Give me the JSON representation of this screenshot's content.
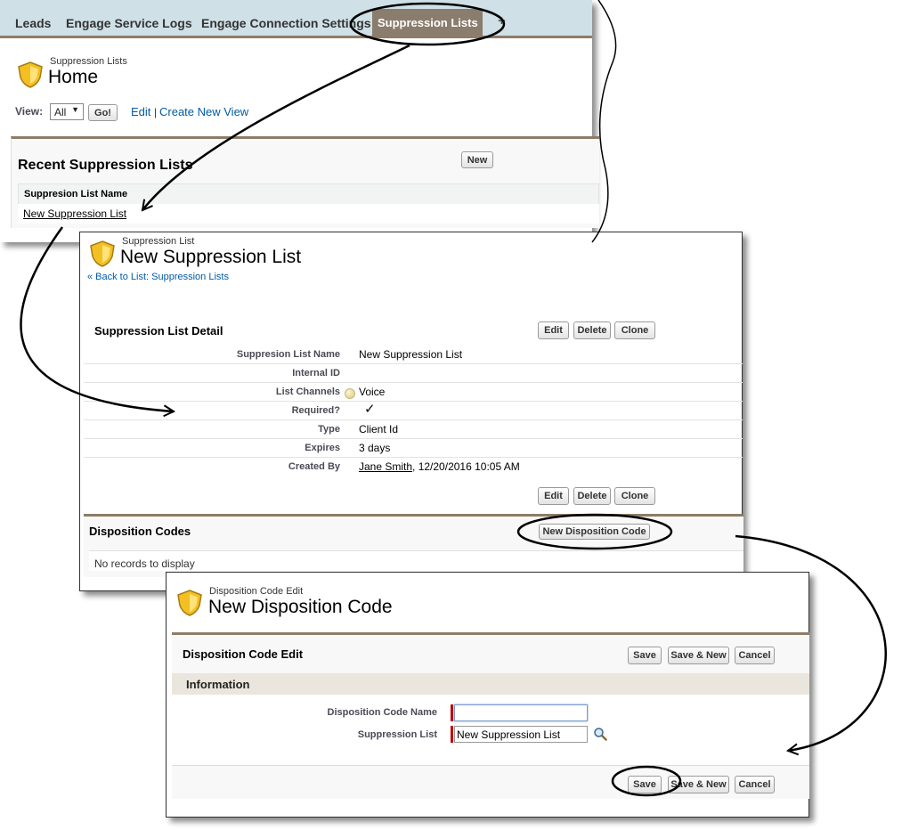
{
  "tabs": [
    "Leads",
    "Engage Service Logs",
    "Engage Connection Settings",
    "Suppression Lists"
  ],
  "tab_plus": "+",
  "home": {
    "object_label": "Suppression Lists",
    "title": "Home",
    "view_label": "View:",
    "view_value": "All",
    "go_label": "Go!",
    "edit_link": "Edit",
    "separator": "|",
    "create_view_link": "Create New View",
    "recent_title": "Recent Suppression Lists",
    "new_button": "New",
    "column_header": "Suppresion List Name",
    "row_link": "New Suppression List"
  },
  "detail": {
    "object_label": "Suppression List",
    "title": "New Suppression List",
    "back_link": "« Back to List: Suppression Lists",
    "section_title": "Suppression List Detail",
    "buttons": [
      "Edit",
      "Delete",
      "Clone"
    ],
    "fields": [
      {
        "label": "Suppresion List Name",
        "value": "New Suppression List"
      },
      {
        "label": "Internal ID",
        "value": ""
      },
      {
        "label": "List Channels",
        "value": "Voice"
      },
      {
        "label": "Required?",
        "value": "✓"
      },
      {
        "label": "Type",
        "value": "Client Id"
      },
      {
        "label": "Expires",
        "value": "3 days"
      },
      {
        "label": "Created By",
        "value_link": "Jane Smith",
        "value": ", 12/20/2016 10:05 AM"
      }
    ],
    "related_title": "Disposition Codes",
    "related_button": "New Disposition Code",
    "empty_text": "No records to display"
  },
  "edit": {
    "object_label": "Disposition Code Edit",
    "title": "New Disposition Code",
    "section_title": "Disposition Code Edit",
    "buttons": [
      "Save",
      "Save & New",
      "Cancel"
    ],
    "info_header": "Information",
    "name_label": "Disposition Code Name",
    "name_value": "",
    "list_label": "Suppression List",
    "list_value": "New Suppression List"
  },
  "colors": {
    "tab_bar": "#cfe0e7",
    "active_tab": "#8a7d6e",
    "section_border": "#8e7c68",
    "link": "#015ba7",
    "required": "#c00000"
  },
  "icons": [
    "shield-icon",
    "lookup-icon",
    "checkmark-icon",
    "help-bubble-icon"
  ]
}
